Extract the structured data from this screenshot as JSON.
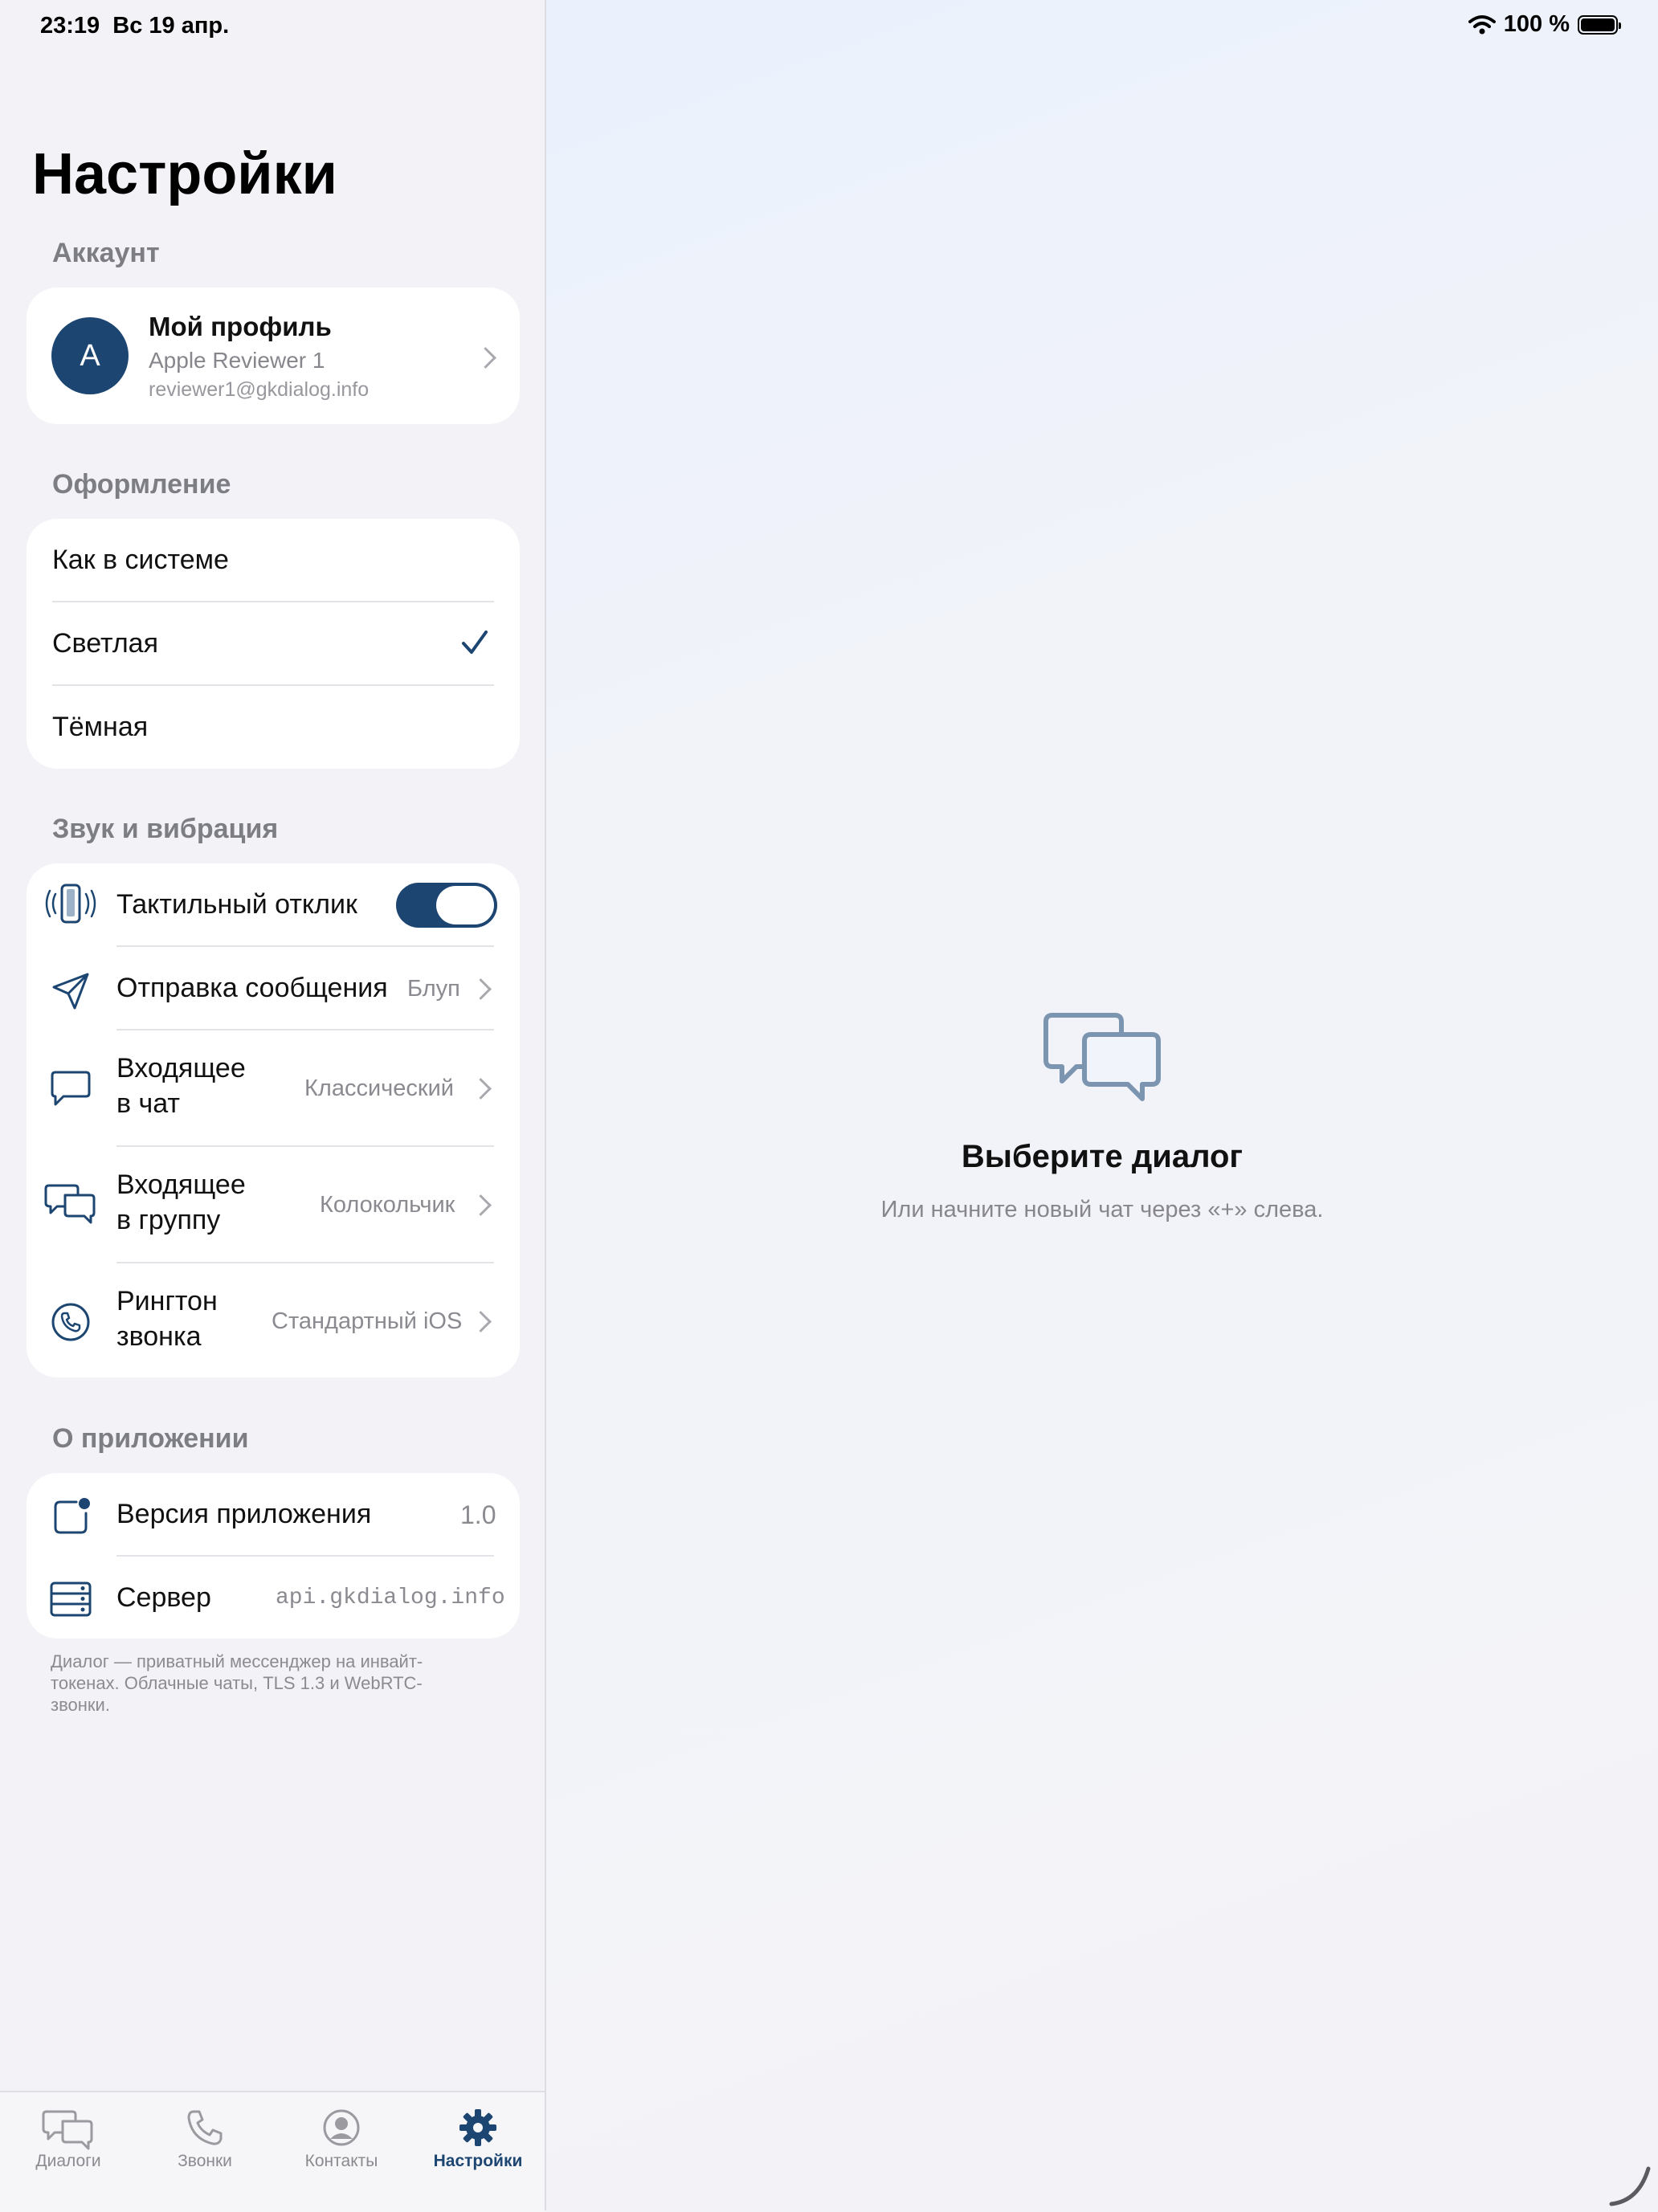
{
  "status_bar": {
    "time": "23:19",
    "date": "Вс 19 апр.",
    "battery": "100 %"
  },
  "settings": {
    "title": "Настройки",
    "account": {
      "header": "Аккаунт",
      "avatar_letter": "A",
      "name": "Мой профиль",
      "subtitle": "Apple Reviewer 1",
      "email": "reviewer1@gkdialog.info"
    },
    "appearance": {
      "header": "Оформление",
      "options": [
        "Как в системе",
        "Светлая",
        "Тёмная"
      ],
      "selected": "Светлая"
    },
    "sound": {
      "header": "Звук и вибрация",
      "haptic_label": "Тактильный отклик",
      "haptic_on": true,
      "send_label": "Отправка сообщения",
      "send_value": "Блуп",
      "chat_label_1": "Входящее",
      "chat_label_2": "в чат",
      "chat_value": "Классический",
      "group_label_1": "Входящее",
      "group_label_2": "в группу",
      "group_value": "Колокольчик",
      "ring_label_1": "Рингтон",
      "ring_label_2": "звонка",
      "ring_value": "Стандартный iOS"
    },
    "about": {
      "header": "О приложении",
      "version_label": "Версия приложения",
      "version_value": "1.0",
      "server_label": "Сервер",
      "server_value": "api.gkdialog.info"
    },
    "footnote": "Диалог — приватный мессенджер на инвайт-токенах. Облачные чаты, TLS 1.3 и WebRTC-звонки."
  },
  "tabs": [
    {
      "label": "Диалоги",
      "icon": "chats-icon"
    },
    {
      "label": "Звонки",
      "icon": "phone-icon"
    },
    {
      "label": "Контакты",
      "icon": "person-circle-icon"
    },
    {
      "label": "Настройки",
      "icon": "gear-icon",
      "active": true
    }
  ],
  "empty_state": {
    "title": "Выберите диалог",
    "subtitle": "Или начните новый чат через «+» слева."
  },
  "colors": {
    "accent": "#1c4671",
    "background": "#f2f2f7"
  }
}
